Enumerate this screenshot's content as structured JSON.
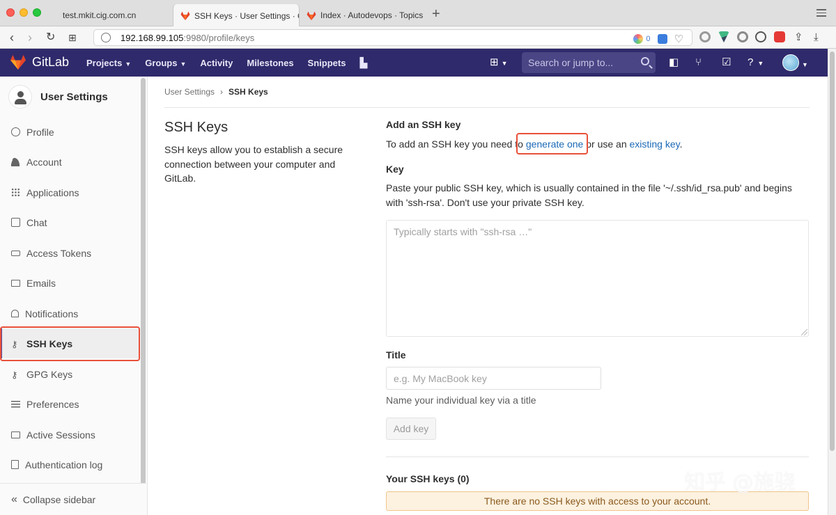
{
  "browser": {
    "tabs": [
      {
        "label": "test.mkit.cig.com.cn"
      },
      {
        "label": "SSH Keys · User Settings · G"
      },
      {
        "label": "Index · Autodevops · Topics"
      }
    ],
    "url_host": "192.168.99.105",
    "url_path": ":9980/profile/keys",
    "ext_badge": "0"
  },
  "header": {
    "brand": "GitLab",
    "nav": [
      "Projects",
      "Groups",
      "Activity",
      "Milestones",
      "Snippets"
    ],
    "search_placeholder": "Search or jump to..."
  },
  "sidebar": {
    "title": "User Settings",
    "items": [
      {
        "label": "Profile"
      },
      {
        "label": "Account"
      },
      {
        "label": "Applications"
      },
      {
        "label": "Chat"
      },
      {
        "label": "Access Tokens"
      },
      {
        "label": "Emails"
      },
      {
        "label": "Notifications"
      },
      {
        "label": "SSH Keys"
      },
      {
        "label": "GPG Keys"
      },
      {
        "label": "Preferences"
      },
      {
        "label": "Active Sessions"
      },
      {
        "label": "Authentication log"
      }
    ],
    "collapse": "Collapse sidebar"
  },
  "breadcrumb": {
    "parent": "User Settings",
    "current": "SSH Keys"
  },
  "page": {
    "title": "SSH Keys",
    "description": "SSH keys allow you to establish a secure connection between your computer and GitLab."
  },
  "form": {
    "add_heading": "Add an SSH key",
    "add_text_pre": "To add an SSH key you need to ",
    "add_link_generate": "generate one",
    "add_text_mid": " or use an ",
    "add_link_existing": "existing key",
    "add_text_post": ".",
    "key_label": "Key",
    "key_help": "Paste your public SSH key, which is usually contained in the file '~/.ssh/id_rsa.pub' and begins with 'ssh-rsa'. Don't use your private SSH key.",
    "key_placeholder": "Typically starts with \"ssh-rsa …\"",
    "title_label": "Title",
    "title_placeholder": "e.g. My MacBook key",
    "title_help": "Name your individual key via a title",
    "submit": "Add key"
  },
  "keys_list": {
    "heading": "Your SSH keys (0)",
    "empty": "There are no SSH keys with access to your account."
  },
  "watermark": "知乎 @施骁",
  "colors": {
    "header_bg": "#2f2a6b",
    "link": "#1b69b6",
    "highlight_box": "#e8503a",
    "warning_bg": "#fdf1e0"
  }
}
